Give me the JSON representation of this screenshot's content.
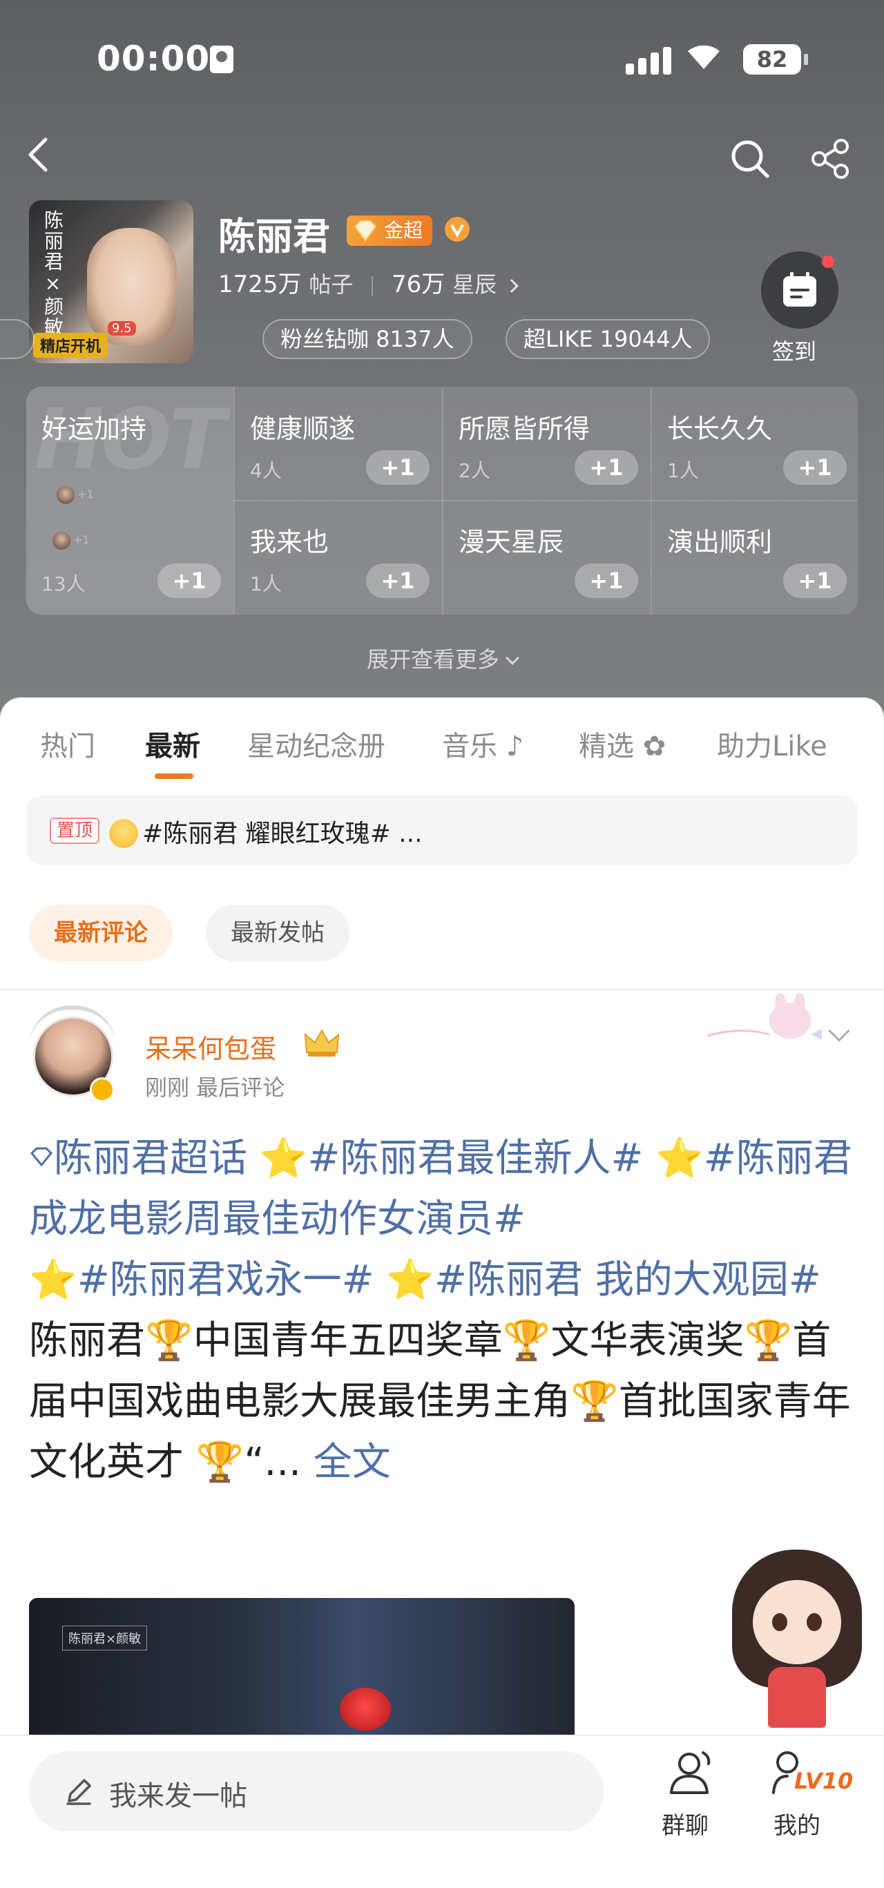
{
  "status_bar": {
    "time": "00:00",
    "battery": "82"
  },
  "group": {
    "name": "陈丽君",
    "badge_label": "金超",
    "posts_count": "1725万",
    "posts_label": "帖子",
    "stardust_count": "76万",
    "stardust_label": "星辰",
    "cover_text": "陈丽君×颜敏",
    "cover_tag": "精店开机",
    "cover_score": "9.5",
    "pills": [
      "粉丝钻咖 8137人",
      "超LIKE 19044人"
    ],
    "checkin_label": "签到"
  },
  "wishes": {
    "hot_watermark": "HOT",
    "featured": {
      "title": "好运加持",
      "count": "13人",
      "mini_plus": "+1"
    },
    "items": [
      {
        "title": "健康顺遂",
        "count": "4人"
      },
      {
        "title": "所愿皆所得",
        "count": "2人"
      },
      {
        "title": "长长久久",
        "count": "1人"
      },
      {
        "title": "我来也",
        "count": "1人"
      },
      {
        "title": "漫天星辰",
        "count": ""
      },
      {
        "title": "演出顺利",
        "count": ""
      }
    ],
    "plus_label": "+1",
    "expand_label": "展开查看更多"
  },
  "tabs": [
    "热门",
    "最新",
    "星动纪念册",
    "音乐",
    "精选",
    "助力Like"
  ],
  "active_tab": "最新",
  "pinned": {
    "tag": "置顶",
    "text": "#陈丽君 耀眼红玫瑰# ..."
  },
  "filters": {
    "active": "最新评论",
    "inactive": "最新发帖"
  },
  "post": {
    "author": "呆呆何包蛋",
    "time": "刚刚 最后评论",
    "line1_a": "陈丽君超话 ",
    "line1_b": "#陈丽君最佳新人# ",
    "line1_c": "#陈丽君成龙电影周最佳动作女演员#",
    "line3_a": "#陈丽君戏永一# ",
    "line3_b": "#陈丽君 我的大观园#",
    "body_1": "陈丽君",
    "body_2": "中国青年五四奖章",
    "body_3": "文华表演奖",
    "body_4": "首届中国戏曲电影大展最佳男主角",
    "body_5": "首批国家青年文化英才 ",
    "body_6": "“...",
    "full_text": "全文",
    "image_caption": "陈丽君×颜敏"
  },
  "bottom_bar": {
    "compose_placeholder": "我来发一帖",
    "group_chat_label": "群聊",
    "mine_label": "我的",
    "level": "LV10"
  },
  "colors": {
    "accent": "#f27a1a",
    "topic_link": "#4f6fa6",
    "header_bg": "#6b6d71"
  }
}
